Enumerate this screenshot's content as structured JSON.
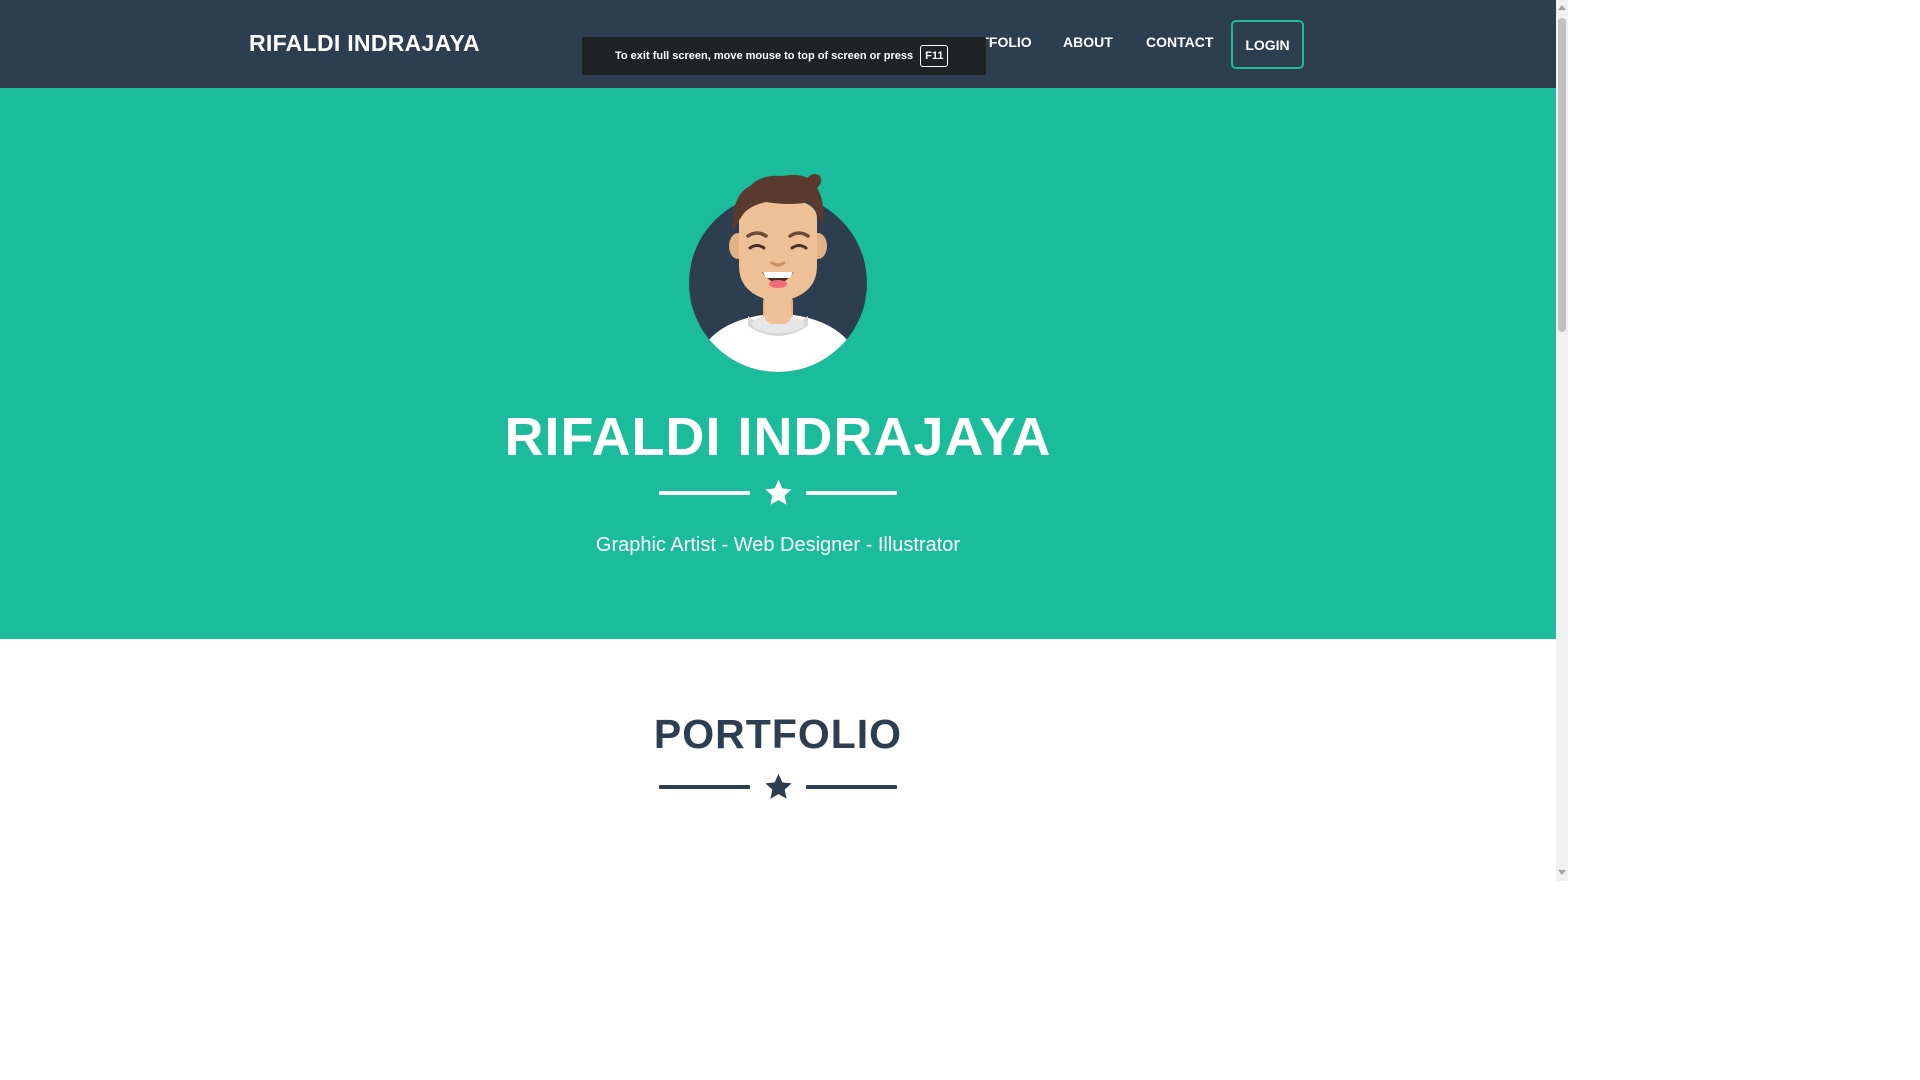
{
  "navbar": {
    "brand": "RIFALDI INDRAJAYA",
    "links": [
      "PORTFOLIO",
      "ABOUT",
      "CONTACT"
    ],
    "login_label": "LOGIN"
  },
  "fullscreen_notice": {
    "message": "To exit full screen, move mouse to top of screen or press",
    "key": "F11"
  },
  "hero": {
    "avatar_icon": "smiling-man-avatar",
    "title": "RIFALDI INDRAJAYA",
    "divider_icon": "star-icon",
    "subtitle": "Graphic Artist - Web Designer - Illustrator"
  },
  "portfolio": {
    "title": "PORTFOLIO",
    "divider_icon": "star-icon"
  },
  "colors": {
    "navbar_bg": "#2c3e50",
    "hero_bg": "#1abc9c",
    "accent": "#1abc9c",
    "text_dark": "#2c3e50",
    "text_light": "#ffffff"
  }
}
